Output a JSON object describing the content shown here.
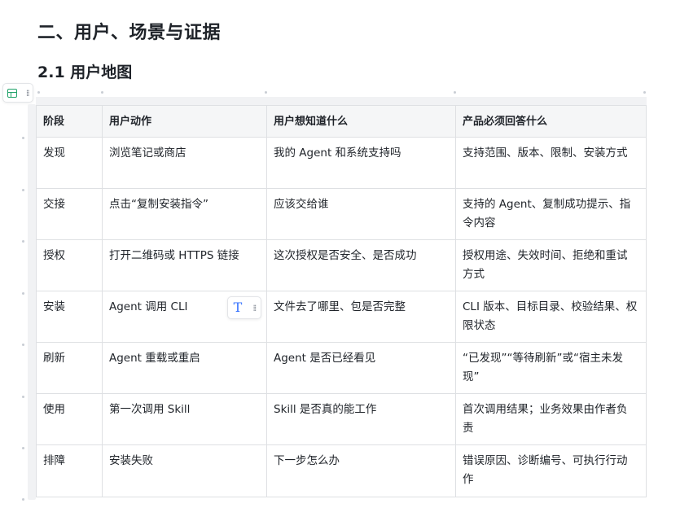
{
  "heading1": "二、用户、场景与证据",
  "heading2": "2.1 用户地图",
  "table": {
    "headers": [
      "阶段",
      "用户动作",
      "用户想知道什么",
      "产品必须回答什么"
    ],
    "rows": [
      [
        "发现",
        "浏览笔记或商店",
        "我的 Agent 和系统支持吗",
        "支持范围、版本、限制、安装方式"
      ],
      [
        "交接",
        "点击“复制安装指令”",
        "应该交给谁",
        "支持的 Agent、复制成功提示、指令内容"
      ],
      [
        "授权",
        "打开二维码或 HTTPS 链接",
        "这次授权是否安全、是否成功",
        "授权用途、失效时间、拒绝和重试方式"
      ],
      [
        "安装",
        "Agent 调用 CLI",
        "文件去了哪里、包是否完整",
        "CLI 版本、目标目录、校验结果、权限状态"
      ],
      [
        "刷新",
        "Agent 重载或重启",
        "Agent 是否已经看见",
        "“已发现”“等待刷新”或“宿主未发现”"
      ],
      [
        "使用",
        "第一次调用 Skill",
        "Skill 是否真的能工作",
        "首次调用结果；业务效果由作者负责"
      ],
      [
        "排障",
        "安装失败",
        "下一步怎么办",
        "错误原因、诊断编号、可执行行动作"
      ]
    ]
  },
  "icons": {
    "block_handle": "table-icon",
    "drag": "drag-grip-icon",
    "text_tool": "text-format-icon"
  },
  "colors": {
    "table_icon": "#22a36a",
    "text_tool": "#3370ff",
    "header_bg": "#f5f6f7",
    "border": "#dee0e3"
  }
}
